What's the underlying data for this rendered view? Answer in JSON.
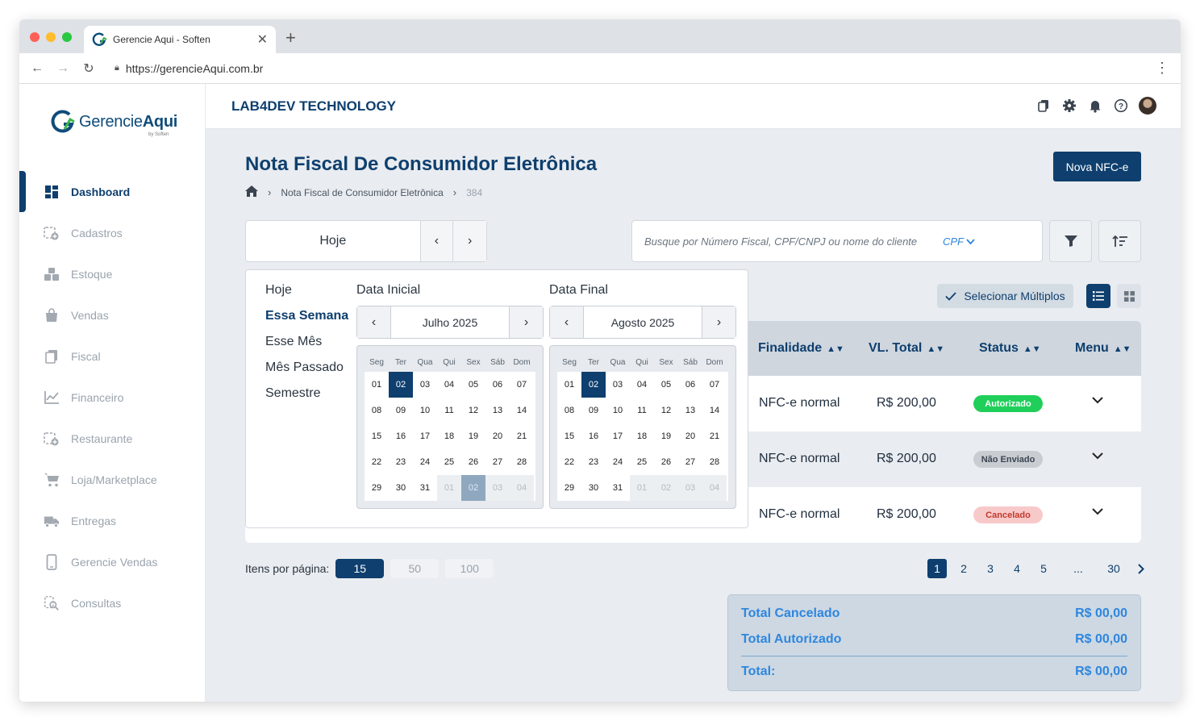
{
  "browser": {
    "tab_title": "Gerencie Aqui - Soften",
    "url": "https://gerencieAqui.com.br"
  },
  "logo": {
    "part1": "Gerencie",
    "part2": "Aqui",
    "by": "by Soften"
  },
  "sidebar": {
    "items": [
      {
        "label": "Dashboard",
        "icon": "dashboard-icon",
        "active": true
      },
      {
        "label": "Cadastros",
        "icon": "add-box-icon"
      },
      {
        "label": "Estoque",
        "icon": "boxes-icon"
      },
      {
        "label": "Vendas",
        "icon": "shopping-bag-icon"
      },
      {
        "label": "Fiscal",
        "icon": "documents-icon"
      },
      {
        "label": "Financeiro",
        "icon": "chart-line-icon"
      },
      {
        "label": "Restaurante",
        "icon": "add-box-icon"
      },
      {
        "label": "Loja/Marketplace",
        "icon": "cart-icon"
      },
      {
        "label": "Entregas",
        "icon": "truck-icon"
      },
      {
        "label": "Gerencie Vendas",
        "icon": "phone-icon"
      },
      {
        "label": "Consultas",
        "icon": "search-doc-icon"
      }
    ]
  },
  "header": {
    "company": "LAB4DEV TECHNOLOGY"
  },
  "page": {
    "title": "Nota Fiscal De Consumidor Eletrônica",
    "breadcrumb": [
      "Nota Fiscal de Consumidor Eletrônica",
      "384"
    ],
    "new_button": "Nova NFC-e"
  },
  "filter": {
    "date_label": "Hoje",
    "search_placeholder": "Busque por Número Fiscal, CPF/CNPJ ou nome do cliente",
    "search_type": "CPF"
  },
  "picker": {
    "presets": [
      "Hoje",
      "Essa Semana",
      "Esse Mês",
      "Mês Passado",
      "Semestre"
    ],
    "selected_preset": "Essa Semana",
    "start_label": "Data Inicial",
    "end_label": "Data Final",
    "weekdays": [
      "Seg",
      "Ter",
      "Qua",
      "Qui",
      "Sex",
      "Sáb",
      "Dom"
    ],
    "start_month": "Julho 2025",
    "end_month": "Agosto 2025",
    "start_days": [
      "01",
      "02",
      "03",
      "04",
      "05",
      "06",
      "07",
      "08",
      "09",
      "10",
      "11",
      "12",
      "13",
      "14",
      "15",
      "16",
      "17",
      "18",
      "19",
      "20",
      "21",
      "22",
      "23",
      "24",
      "25",
      "26",
      "27",
      "28",
      "29",
      "30",
      "31",
      "01",
      "02",
      "03",
      "04"
    ],
    "end_days": [
      "01",
      "02",
      "03",
      "04",
      "05",
      "06",
      "07",
      "08",
      "09",
      "10",
      "11",
      "12",
      "13",
      "14",
      "15",
      "16",
      "17",
      "18",
      "19",
      "20",
      "21",
      "22",
      "23",
      "24",
      "25",
      "26",
      "27",
      "28",
      "29",
      "30",
      "31",
      "01",
      "02",
      "03",
      "04"
    ],
    "current_month_count": 31,
    "start_selected_index": 1,
    "end_selected_index": 1,
    "start_out_selected_index": 32
  },
  "table": {
    "multi_select": "Selecionar Múltiplos",
    "columns": [
      "Finalidade",
      "VL. Total",
      "Status",
      "Menu"
    ],
    "rows": [
      {
        "finalidade": "NFC-e normal",
        "total": "R$ 200,00",
        "status": "Autorizado"
      },
      {
        "finalidade": "NFC-e normal",
        "total": "R$ 200,00",
        "status": "Não Enviado"
      },
      {
        "finalidade": "NFC-e normal",
        "total": "R$ 200,00",
        "status": "Cancelado"
      }
    ]
  },
  "pagination": {
    "label": "Itens por página:",
    "sizes": [
      "15",
      "50",
      "100"
    ],
    "pages": [
      "1",
      "2",
      "3",
      "4",
      "5",
      "...",
      "30"
    ],
    "current": "1"
  },
  "totals": {
    "cancelado_label": "Total Cancelado",
    "cancelado": "R$ 00,00",
    "autorizado_label": "Total Autorizado",
    "autorizado": "R$ 00,00",
    "total_label": "Total:",
    "total": "R$ 00,00"
  },
  "colors": {
    "primary": "#0e3f6e",
    "accent": "#2e86de",
    "badge_ok": "#1fcf5a",
    "badge_pending": "#c9cdd2",
    "badge_cancel": "#f8c9c9"
  }
}
